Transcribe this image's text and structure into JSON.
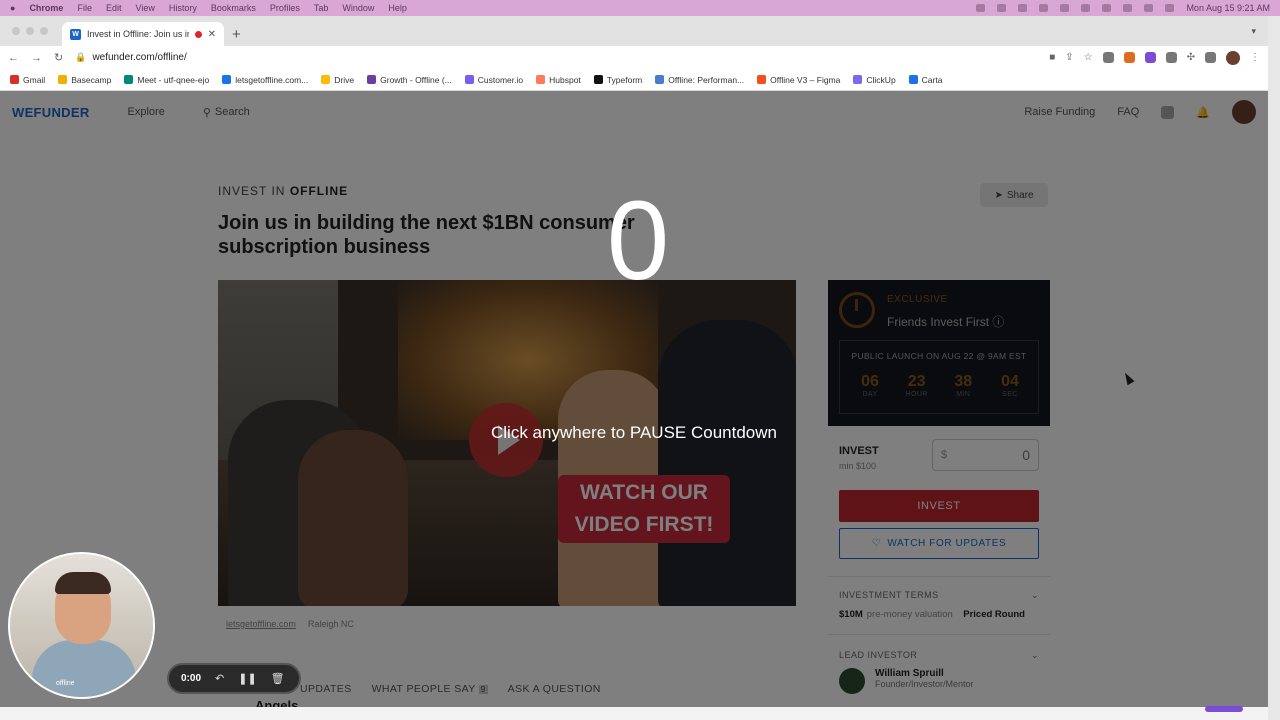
{
  "mac_menu": {
    "apple": "",
    "app": "Chrome",
    "items": [
      "File",
      "Edit",
      "View",
      "History",
      "Bookmarks",
      "Profiles",
      "Tab",
      "Window",
      "Help"
    ],
    "datetime": "Mon Aug 15  9:21 AM"
  },
  "browser": {
    "tab_title": "Invest in Offline: Join us in",
    "tab_favicon": "W",
    "new_tab": "+",
    "url": "wefunder.com/offline/",
    "bookmarks": [
      {
        "label": "Gmail",
        "color": "#d93025"
      },
      {
        "label": "Basecamp",
        "color": "#f1b000"
      },
      {
        "label": "Meet - utf-qnee-ejo",
        "color": "#00897b"
      },
      {
        "label": "letsgetoffline.com...",
        "color": "#1a73e8"
      },
      {
        "label": "Drive",
        "color": "#fbbc04"
      },
      {
        "label": "Growth - Offline (...",
        "color": "#6b3fa0"
      },
      {
        "label": "Customer.io",
        "color": "#7a5ef0"
      },
      {
        "label": "Hubspot",
        "color": "#ff7a59"
      },
      {
        "label": "Typeform",
        "color": "#111111"
      },
      {
        "label": "Offline: Performan...",
        "color": "#4a7bd1"
      },
      {
        "label": "Offline V3 – Figma",
        "color": "#f24e1e"
      },
      {
        "label": "ClickUp",
        "color": "#7b68ee"
      },
      {
        "label": "Carta",
        "color": "#1a73e8"
      }
    ]
  },
  "wefunder_nav": {
    "logo": "WEFUNDER",
    "explore": "Explore",
    "search": "Search",
    "raise_funding": "Raise Funding",
    "faq": "FAQ"
  },
  "hero": {
    "eyebrow_prefix": "INVEST IN",
    "eyebrow_company": "OFFLINE",
    "headline": "Join us in building the next $1BN consumer subscription business",
    "share": "Share",
    "video_badge_line1": "WATCH OUR",
    "video_badge_line2": "VIDEO FIRST!",
    "caption_site": "letsgetoffline.com",
    "caption_location": "Raleigh NC"
  },
  "exclusive_card": {
    "label": "EXCLUSIVE",
    "title": "Friends Invest First",
    "launch": "PUBLIC LAUNCH ON AUG 22 @ 9AM EST",
    "countdown": [
      {
        "value": "06",
        "unit": "DAY"
      },
      {
        "value": "23",
        "unit": "HOUR"
      },
      {
        "value": "38",
        "unit": "MIN"
      },
      {
        "value": "04",
        "unit": "SEC"
      }
    ]
  },
  "invest": {
    "label": "INVEST",
    "min": "min $100",
    "currency": "$",
    "amount": "0",
    "button": "INVEST",
    "watch_button": "WATCH FOR UPDATES",
    "terms_header": "INVESTMENT TERMS",
    "valuation_value": "$10M",
    "valuation_text": "pre-money valuation",
    "round_type": "Priced Round",
    "lead_header": "LEAD INVESTOR",
    "lead_name": "William Spruill",
    "lead_role": "Founder/Investor/Mentor"
  },
  "page_tabs": {
    "updates": "UPDATES",
    "what_people_say": "WHAT PEOPLE SAY",
    "what_people_say_count": "9",
    "ask": "ASK A QUESTION"
  },
  "subhead": "Angels",
  "overlay": {
    "countdown_number": "0",
    "message": "Click anywhere to PAUSE Countdown"
  },
  "recorder": {
    "time": "0:00"
  },
  "webcam": {
    "shirt_text": "offline"
  }
}
